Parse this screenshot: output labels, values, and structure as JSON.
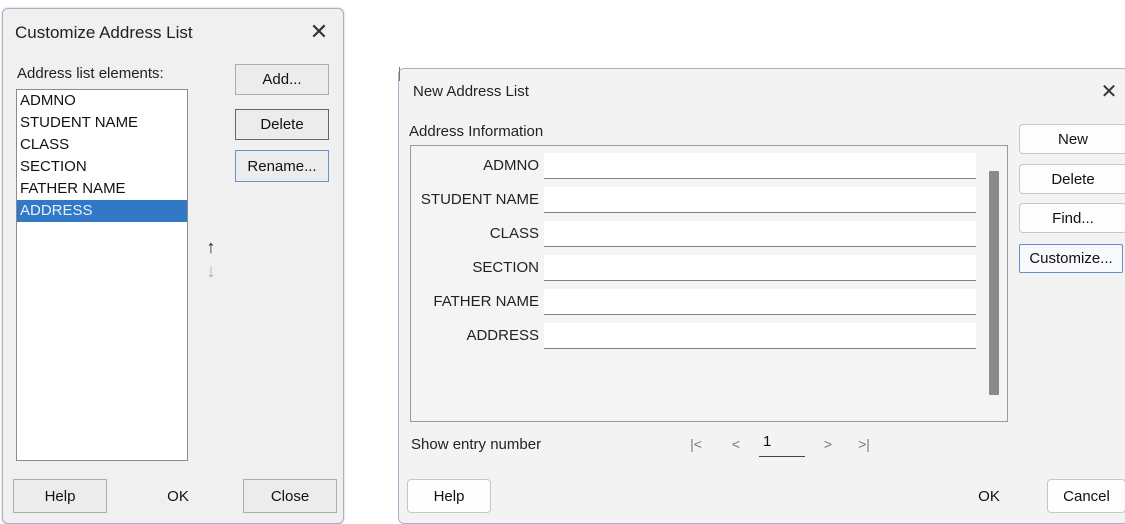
{
  "customize_dialog": {
    "title": "Customize Address List",
    "close_glyph": "✕",
    "list_label": "Address list elements:",
    "elements": [
      {
        "label": "ADMNO",
        "selected": false
      },
      {
        "label": "STUDENT NAME",
        "selected": false
      },
      {
        "label": "CLASS",
        "selected": false
      },
      {
        "label": "SECTION",
        "selected": false
      },
      {
        "label": "FATHER NAME",
        "selected": false
      },
      {
        "label": "ADDRESS",
        "selected": true
      }
    ],
    "buttons": {
      "add": "Add...",
      "delete": "Delete",
      "rename": "Rename...",
      "help": "Help",
      "ok": "OK",
      "close": "Close"
    },
    "move_up_glyph": "↑",
    "move_down_glyph": "↓"
  },
  "new_address_dialog": {
    "title": "New Address List",
    "close_glyph": "✕",
    "section_label": "Address Information",
    "fields": [
      {
        "label": "ADMNO",
        "value": ""
      },
      {
        "label": "STUDENT NAME",
        "value": ""
      },
      {
        "label": "CLASS",
        "value": ""
      },
      {
        "label": "SECTION",
        "value": ""
      },
      {
        "label": "FATHER NAME",
        "value": ""
      },
      {
        "label": "ADDRESS",
        "value": ""
      }
    ],
    "buttons": {
      "new": "New",
      "delete": "Delete",
      "find": "Find...",
      "customize": "Customize...",
      "help": "Help",
      "ok": "OK",
      "cancel": "Cancel"
    },
    "show_entry_label": "Show entry number",
    "nav": {
      "first": "|<",
      "prev": "<",
      "entry_number": "1",
      "next": ">",
      "last": ">|"
    }
  },
  "colors": {
    "selection": "#3178c6",
    "dialog_bg": "#f0f0f0",
    "focus_border": "#5f8ec9"
  }
}
